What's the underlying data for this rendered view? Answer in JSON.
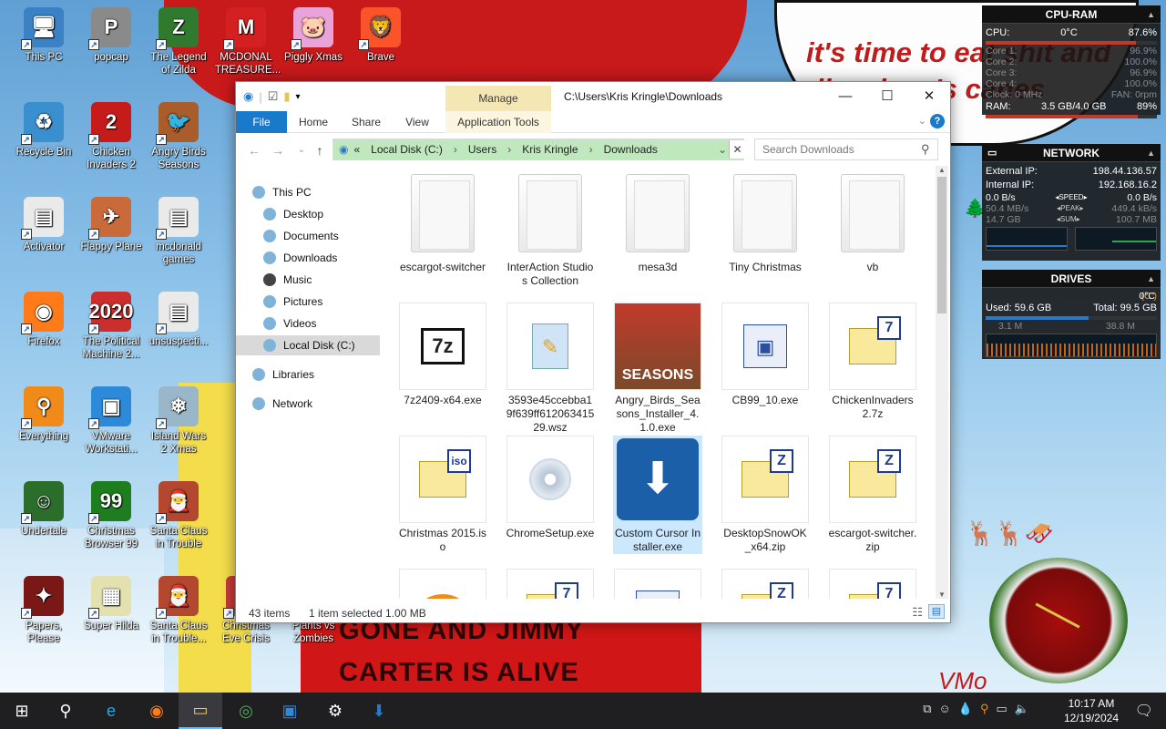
{
  "wallpaper": {
    "bubble_text": "it's time to eat shit and die... how's canes",
    "bottom_line1": "GONE AND JIMMY",
    "bottom_line2": "CARTER IS ALIVE",
    "signature": "VMo"
  },
  "desktop_icons": [
    {
      "label": "This PC",
      "icon": "this-pc-icon",
      "glyph": "🖥",
      "color": "#3b82c4"
    },
    {
      "label": "popcap",
      "icon": "popcap-icon",
      "glyph": "P",
      "color": "#8a8a8a"
    },
    {
      "label": "The Legend of Zilda",
      "icon": "zelda-icon",
      "glyph": "Z",
      "color": "#2f7a2f"
    },
    {
      "label": "MCDONAL TREASURE...",
      "icon": "mcdonalds-icon",
      "glyph": "M",
      "color": "#d42020"
    },
    {
      "label": "Piggly Xmas",
      "icon": "piggly-icon",
      "glyph": "🐷",
      "color": "#e9a3d8"
    },
    {
      "label": "Brave",
      "icon": "brave-icon",
      "glyph": "🦁",
      "color": "#fb542b"
    },
    {
      "label": "Recycle Bin",
      "icon": "recycle-bin-icon",
      "glyph": "♻",
      "color": "#3a8fcf"
    },
    {
      "label": "Chicken Invaders 2",
      "icon": "chicken-invaders-icon",
      "glyph": "2",
      "color": "#c61b1b"
    },
    {
      "label": "Angry Birds Seasons",
      "icon": "angry-birds-icon",
      "glyph": "🐦",
      "color": "#a85d2a"
    },
    {
      "label": "Activator",
      "icon": "activator-icon",
      "glyph": "▤",
      "color": "#eaeaea"
    },
    {
      "label": "Flappy Plane",
      "icon": "flappy-plane-icon",
      "glyph": "✈",
      "color": "#c86a3a"
    },
    {
      "label": "mcdonald games",
      "icon": "folder-icon",
      "glyph": "▤",
      "color": "#eaeaea"
    },
    {
      "label": "Firefox",
      "icon": "firefox-icon",
      "glyph": "◉",
      "color": "#ff7a18"
    },
    {
      "label": "The Political Machine 2...",
      "icon": "political-machine-icon",
      "glyph": "2020",
      "color": "#cc2d2d"
    },
    {
      "label": "unsuspecti...",
      "icon": "folder-icon",
      "glyph": "▤",
      "color": "#eaeaea"
    },
    {
      "label": "Everything",
      "icon": "everything-icon",
      "glyph": "⚲",
      "color": "#f08a18"
    },
    {
      "label": "VMware Workstati...",
      "icon": "vmware-icon",
      "glyph": "▣",
      "color": "#2c8ad8"
    },
    {
      "label": "Island Wars 2 Xmas",
      "icon": "island-wars-icon",
      "glyph": "❄",
      "color": "#9ab7c9"
    },
    {
      "label": "Undertale",
      "icon": "undertale-icon",
      "glyph": "☺",
      "color": "#2b6e2b"
    },
    {
      "label": "Christmas Browser 99",
      "icon": "christmas-browser-icon",
      "glyph": "99",
      "color": "#1e7d1e"
    },
    {
      "label": "Santa Claus in Trouble",
      "icon": "santa-claus-icon",
      "glyph": "🎅",
      "color": "#b4482f"
    },
    {
      "label": "Papers, Please",
      "icon": "papers-please-icon",
      "glyph": "✦",
      "color": "#7a1717"
    },
    {
      "label": "Super Hilda",
      "icon": "super-hilda-icon",
      "glyph": "▦",
      "color": "#e3e1b0"
    },
    {
      "label": "Santa Claus in Trouble...",
      "icon": "santa-claus-icon",
      "glyph": "🎅",
      "color": "#b4482f"
    },
    {
      "label": "Christmas Eve Crisis",
      "icon": "christmas-eve-icon",
      "glyph": "🎄",
      "color": "#c73a3a"
    },
    {
      "label": "Plants vs Zombies",
      "icon": "pvz-icon",
      "glyph": "🌻",
      "color": "#e5a62a"
    }
  ],
  "cpu_ram": {
    "title": "CPU-RAM",
    "cpu_label": "CPU:",
    "cpu_temp": "0°C",
    "cpu_pct": "87.6%",
    "cpu_fraction": 0.876,
    "cores": [
      {
        "label": "Core 1:",
        "value": "96.9%"
      },
      {
        "label": "Core 2:",
        "value": "100.0%"
      },
      {
        "label": "Core 3:",
        "value": "96.9%"
      },
      {
        "label": "Core 4:",
        "value": "100.0%"
      }
    ],
    "clock": "Clock: 0 MHz",
    "fan": "FAN: 0rpm",
    "ram_label": "RAM:",
    "ram_value": "3.5 GB/4.0 GB",
    "ram_pct": "89%",
    "ram_fraction": 0.89
  },
  "network": {
    "title": "NETWORK",
    "external_label": "External IP:",
    "external_ip": "198.44.136.57",
    "internal_label": "Internal IP:",
    "internal_ip": "192.168.16.2",
    "down_speed": "0.0 B/s",
    "speed_label": "SPEED",
    "up_speed": "0.0 B/s",
    "down_peak": "50.4 MB/s",
    "peak_label": "PEAK",
    "up_peak": "449.4 kB/s",
    "down_sum": "14.7 GB",
    "sum_label": "SUM",
    "up_sum": "100.7 MB"
  },
  "drives": {
    "title": "DRIVES",
    "drive": "(C:)",
    "temp": "0°C",
    "used": "Used: 59.6 GB",
    "total": "Total: 99.5 GB",
    "used_fraction": 0.6,
    "read": "3.1 M",
    "write": "38.8 M"
  },
  "explorer": {
    "manage_label": "Manage",
    "window_title": "C:\\Users\\Kris Kringle\\Downloads",
    "tabs": {
      "file": "File",
      "home": "Home",
      "share": "Share",
      "view": "View",
      "app_tools": "Application Tools"
    },
    "address": [
      "Local Disk (C:)",
      "Users",
      "Kris Kringle",
      "Downloads"
    ],
    "address_prefix": "«",
    "search_placeholder": "Search Downloads",
    "nav": [
      {
        "label": "This PC",
        "icon": "this-pc-icon"
      },
      {
        "label": "Desktop",
        "icon": "desktop-icon"
      },
      {
        "label": "Documents",
        "icon": "documents-icon"
      },
      {
        "label": "Downloads",
        "icon": "downloads-icon"
      },
      {
        "label": "Music",
        "icon": "music-icon"
      },
      {
        "label": "Pictures",
        "icon": "pictures-icon"
      },
      {
        "label": "Videos",
        "icon": "videos-icon"
      },
      {
        "label": "Local Disk (C:)",
        "icon": "drive-icon"
      },
      {
        "label": "Libraries",
        "icon": "libraries-icon"
      },
      {
        "label": "Network",
        "icon": "network-icon"
      }
    ],
    "files": [
      {
        "name": "escargot-switcher",
        "kind": "folder"
      },
      {
        "name": "InterAction Studios Collection",
        "kind": "folder"
      },
      {
        "name": "mesa3d",
        "kind": "folder"
      },
      {
        "name": "Tiny Christmas",
        "kind": "folder"
      },
      {
        "name": "vb",
        "kind": "folder"
      },
      {
        "name": "7z2409-x64.exe",
        "kind": "7z-exe"
      },
      {
        "name": "3593e45ccebba19f639ff61206341529.wsz",
        "kind": "wsz"
      },
      {
        "name": "Angry_Birds_Seasons_Installer_4.1.0.exe",
        "kind": "angry-birds"
      },
      {
        "name": "CB99_10.exe",
        "kind": "installer"
      },
      {
        "name": "ChickenInvaders2.7z",
        "kind": "archive"
      },
      {
        "name": "Christmas 2015.iso",
        "kind": "iso"
      },
      {
        "name": "ChromeSetup.exe",
        "kind": "setup"
      },
      {
        "name": "Custom Cursor Installer.exe",
        "kind": "cursor-installer"
      },
      {
        "name": "DesktopSnowOK_x64.zip",
        "kind": "zip"
      },
      {
        "name": "escargot-switcher.zip",
        "kind": "zip"
      },
      {
        "name": "",
        "kind": "orange-ring"
      },
      {
        "name": "",
        "kind": "archive"
      },
      {
        "name": "",
        "kind": "installer"
      },
      {
        "name": "",
        "kind": "zip"
      },
      {
        "name": "",
        "kind": "archive"
      }
    ],
    "selected_index": 12,
    "status_count": "43 items",
    "status_selected": "1 item selected  1.00 MB"
  },
  "taskbar": {
    "apps": [
      {
        "name": "start",
        "glyph": "⊞"
      },
      {
        "name": "search",
        "glyph": "⚲"
      },
      {
        "name": "edge",
        "glyph": "e"
      },
      {
        "name": "firefox",
        "glyph": "◉"
      },
      {
        "name": "file-explorer",
        "glyph": "▭"
      },
      {
        "name": "chrome",
        "glyph": "◎"
      },
      {
        "name": "vmware",
        "glyph": "▣"
      },
      {
        "name": "settings",
        "glyph": "⚙"
      },
      {
        "name": "cursor-installer",
        "glyph": "⬇"
      }
    ],
    "time": "10:17 AM",
    "date": "12/19/2024"
  },
  "colors": {
    "accent": "#1979ca",
    "address_bg": "#bfe8bf",
    "selection": "#cce8ff",
    "manage_bg": "#f5e7b3"
  }
}
